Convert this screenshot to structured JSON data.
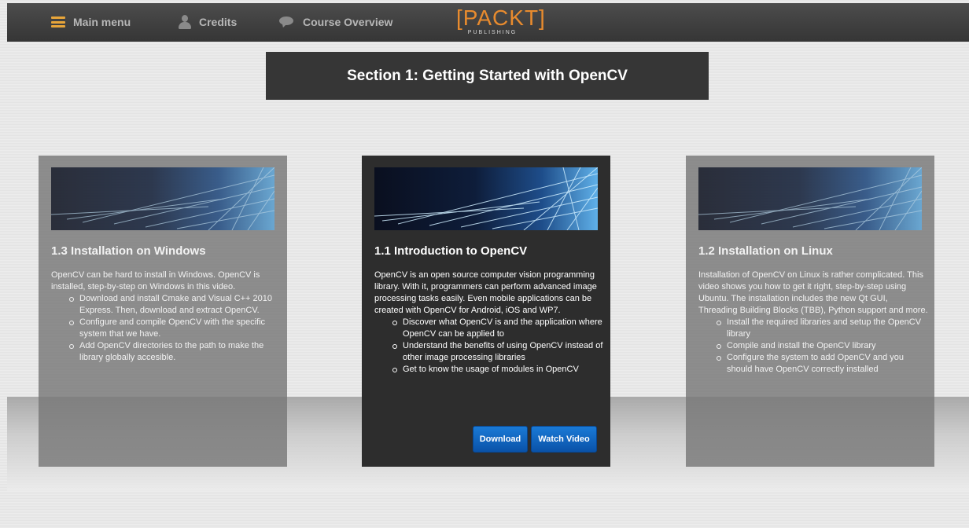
{
  "nav": {
    "main_menu": "Main menu",
    "credits": "Credits",
    "course_overview": "Course Overview",
    "logo_text": "[PACKT]",
    "logo_sub": "PUBLISHING"
  },
  "section": {
    "title": "Section 1: Getting Started with OpenCV"
  },
  "cards": [
    {
      "title": "1.3 Installation on Windows",
      "intro": "OpenCV can be hard to install in Windows. OpenCV is installed, step-by-step on Windows in this video.",
      "bullets": [
        "Download and install Cmake and Visual C++ 2010 Express. Then, download and extract OpenCV.",
        "Configure and compile OpenCV with the specific system that we have.",
        "Add OpenCV directories to the path to make the library globally accesible."
      ]
    },
    {
      "title": "1.1 Introduction to OpenCV",
      "intro": "OpenCV is an open source computer vision programming library. With it, programmers can perform advanced image processing tasks easily. Even mobile applications can be created with OpenCV for Android, iOS and WP7.",
      "bullets": [
        "Discover what OpenCV is and the application where OpenCV can be applied to",
        "Understand the benefits of using OpenCV instead of other image processing libraries",
        "Get to know the usage of modules in OpenCV"
      ],
      "download_label": "Download",
      "watch_label": "Watch Video"
    },
    {
      "title": "1.2 Installation on Linux",
      "intro": "Installation of OpenCV on Linux is rather complicated. This video shows you how to get it right, step-by-step using Ubuntu. The installation includes the new Qt GUI, Threading Building Blocks (TBB), Python support and more.",
      "bullets": [
        "Install the required libraries and setup the OpenCV library",
        "Compile and install the OpenCV library",
        "Configure the system to add OpenCV and you should have OpenCV correctly installed"
      ]
    }
  ],
  "colors": {
    "topbar": "#3f3f3f",
    "accent": "#e88b2e",
    "button": "#0a63c4",
    "card_dark": "#2d2d2d"
  }
}
